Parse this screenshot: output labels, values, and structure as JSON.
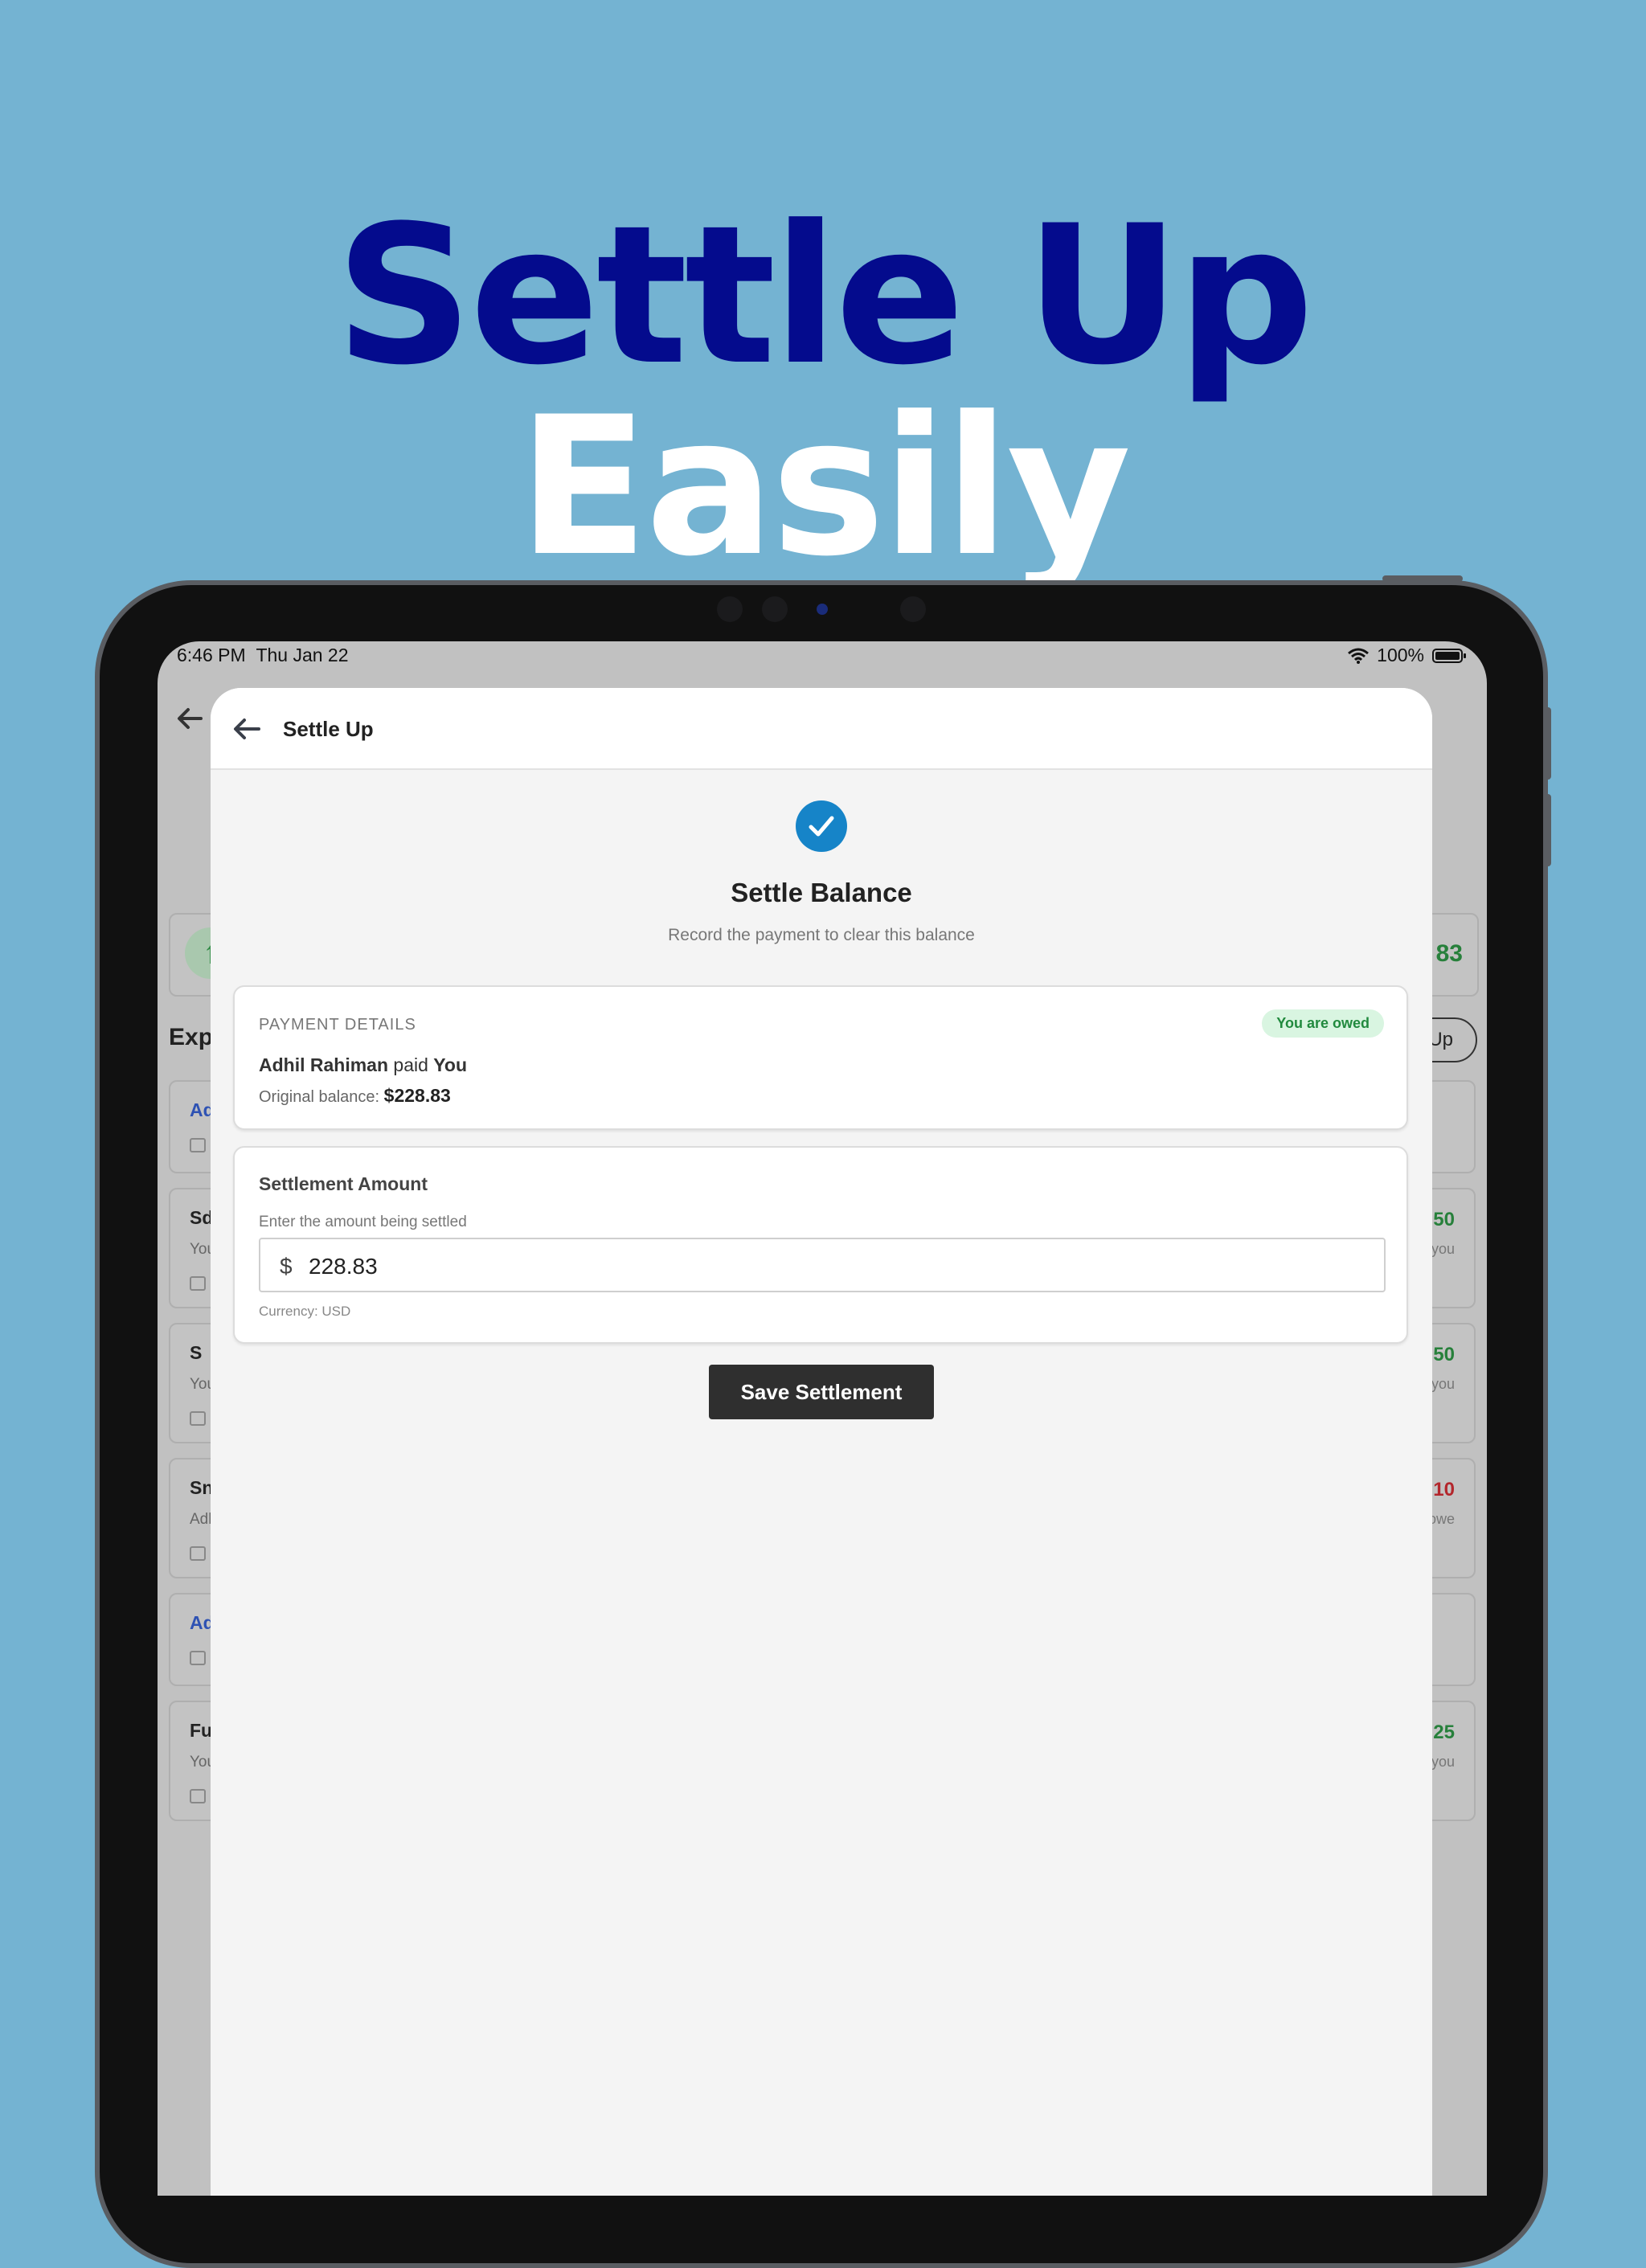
{
  "headline": {
    "part1": "Settle Up",
    "part2": "Easily"
  },
  "status_bar": {
    "time": "6:46 PM",
    "date": "Thu Jan 22",
    "battery": "100%"
  },
  "background_page": {
    "summary_avatar": "↑",
    "summary_amount": "83",
    "section_title": "Exp",
    "action_pill": "Up",
    "cards": [
      {
        "title": "Ad",
        "subtitle": "",
        "amount": "",
        "note": "",
        "title_color": "#2e52b3",
        "amount_color": ""
      },
      {
        "title": "Sd",
        "subtitle": "You",
        "amount": "50",
        "note": "you",
        "title_color": "#222222",
        "amount_color": "#27803b"
      },
      {
        "title": "S",
        "subtitle": "You",
        "amount": "50",
        "note": "you",
        "title_color": "#222222",
        "amount_color": "#27803b"
      },
      {
        "title": "Sn",
        "subtitle": "Adh",
        "amount": ".10",
        "note": "owe",
        "title_color": "#222222",
        "amount_color": "#b3262c"
      },
      {
        "title": "Ad",
        "subtitle": "",
        "amount": "",
        "note": "",
        "title_color": "#2e52b3",
        "amount_color": ""
      },
      {
        "title": "Fu",
        "subtitle": "You",
        "amount": "25",
        "note": "you",
        "title_color": "#222222",
        "amount_color": "#27803b"
      }
    ]
  },
  "modal": {
    "title": "Settle Up",
    "heading": "Settle Balance",
    "subheading": "Record the payment to clear this balance",
    "payment_details": {
      "label": "PAYMENT DETAILS",
      "badge": "You are owed",
      "payer": "Adhil Rahiman",
      "verb": "paid",
      "payee": "You",
      "balance_label": "Original balance:",
      "balance_value": "$228.83"
    },
    "settlement": {
      "title": "Settlement Amount",
      "hint": "Enter the amount being settled",
      "currency_symbol": "$",
      "amount_value": "228.83",
      "currency_note": "Currency: USD"
    },
    "save_label": "Save Settlement"
  },
  "colors": {
    "accent": "#1684c8",
    "headline_dark": "#040b8d",
    "background": "#74b3d2",
    "positive": "#27803b",
    "negative": "#b3262c"
  }
}
